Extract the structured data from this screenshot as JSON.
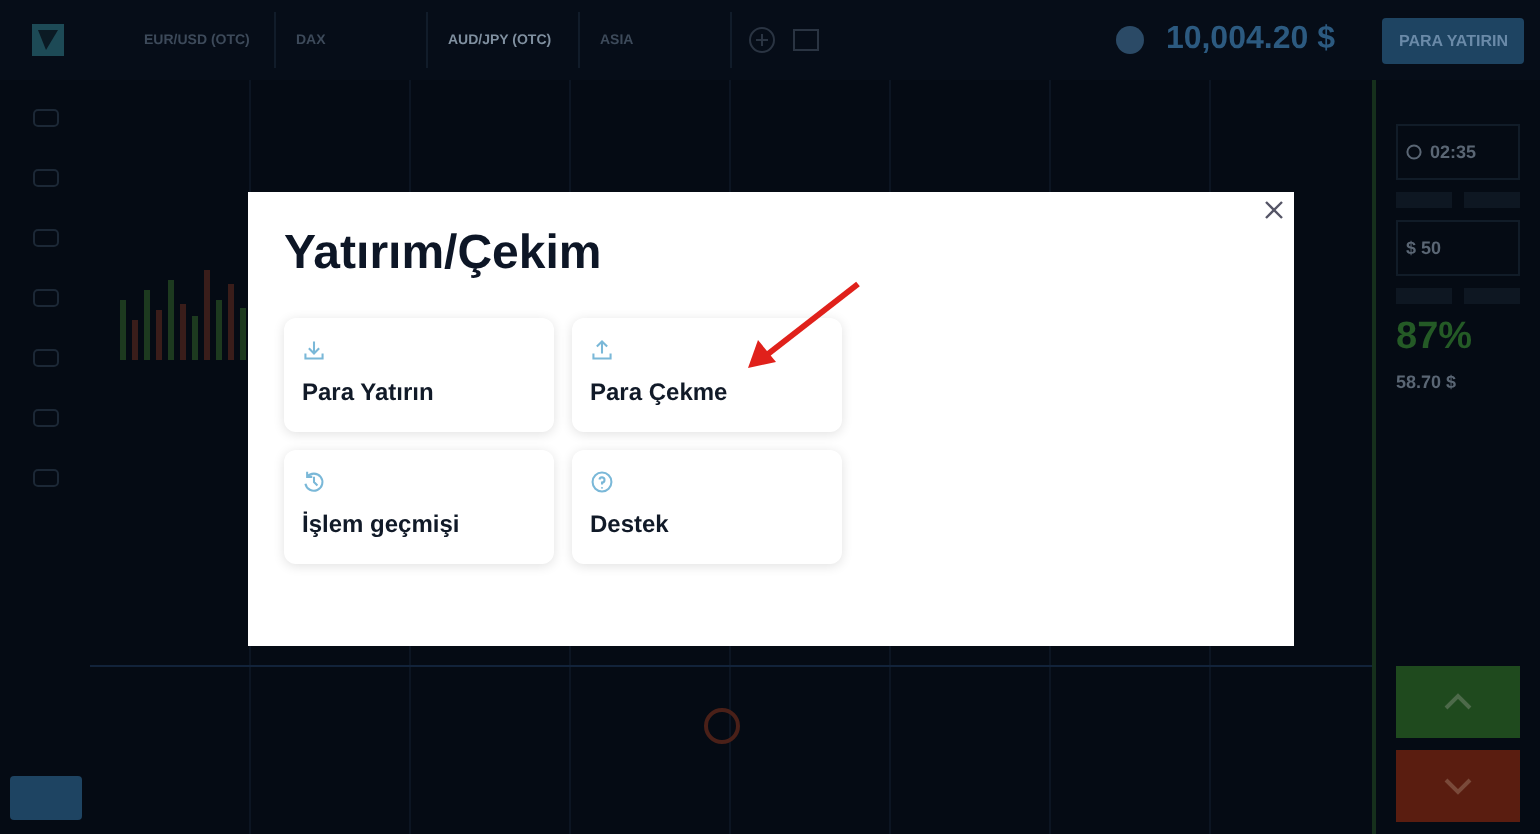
{
  "top_bar": {
    "assets": [
      {
        "name": "EUR/USD (OTC)",
        "selected": false
      },
      {
        "name": "DAX",
        "selected": false
      },
      {
        "name": "AUD/JPY (OTC)",
        "selected": true
      },
      {
        "name": "ASIA",
        "selected": false
      }
    ],
    "balance": "10,004.20 $",
    "deposit_button": "PARA YATIRIN"
  },
  "trade_panel": {
    "time": "02:35",
    "amount": "$ 50",
    "payout": "87%",
    "profit": "58.70 $"
  },
  "dialog": {
    "title": "Yatırım/Çekim",
    "options": [
      {
        "label": "Para Yatırın",
        "kind": "download"
      },
      {
        "label": "Para Çekme",
        "kind": "upload"
      },
      {
        "label": "İşlem geçmişi",
        "kind": "history"
      },
      {
        "label": "Destek",
        "kind": "help"
      }
    ]
  }
}
